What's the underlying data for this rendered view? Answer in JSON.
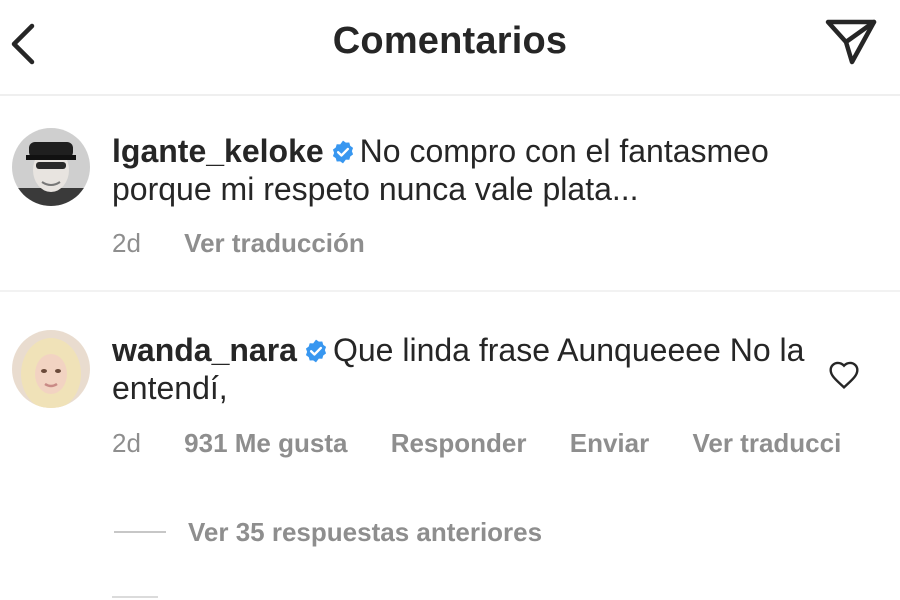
{
  "header": {
    "title": "Comentarios",
    "back_icon": "chevron-left-icon",
    "send_icon": "paper-plane-icon"
  },
  "comments": [
    {
      "username": "lgante_keloke",
      "verified": true,
      "text": "No compro con el fantasmeo porque mi respeto nunca vale plata...",
      "time": "2d",
      "actions": [
        "Ver traducción"
      ]
    },
    {
      "username": "wanda_nara",
      "verified": true,
      "text": "Que linda frase Aunqueeee No la entendí,",
      "time": "2d",
      "likes": "931 Me gusta",
      "actions": [
        "Responder",
        "Enviar",
        "Ver traducci"
      ]
    }
  ],
  "replies": {
    "label": "Ver 35 respuestas anteriores"
  },
  "colors": {
    "text": "#262626",
    "secondary": "#8e8e8e",
    "verified": "#3897f0",
    "divider": "#efefef"
  }
}
